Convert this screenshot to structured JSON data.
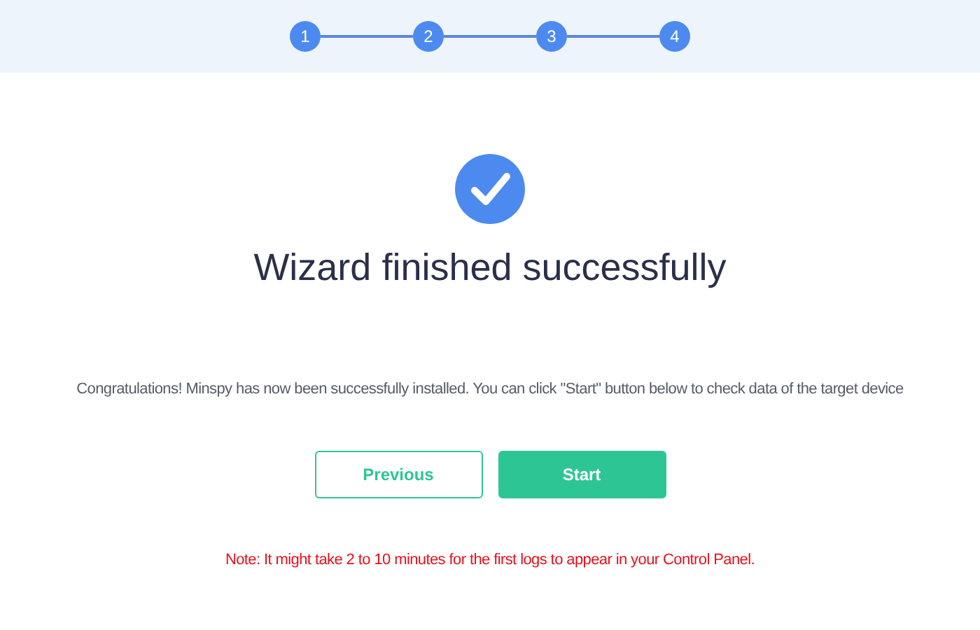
{
  "steps": [
    {
      "label": "1"
    },
    {
      "label": "2"
    },
    {
      "label": "3"
    },
    {
      "label": "4"
    }
  ],
  "title": "Wizard finished successfully",
  "message": "Congratulations! Minspy has now been successfully installed. You can click \"Start\" button below to check data of the target device",
  "buttons": [
    {
      "label": "Previous",
      "kind": "outline"
    },
    {
      "label": "Start",
      "kind": "primary"
    }
  ],
  "note": "Note: It might take 2 to 10 minutes for the first logs to appear in your Control Panel."
}
